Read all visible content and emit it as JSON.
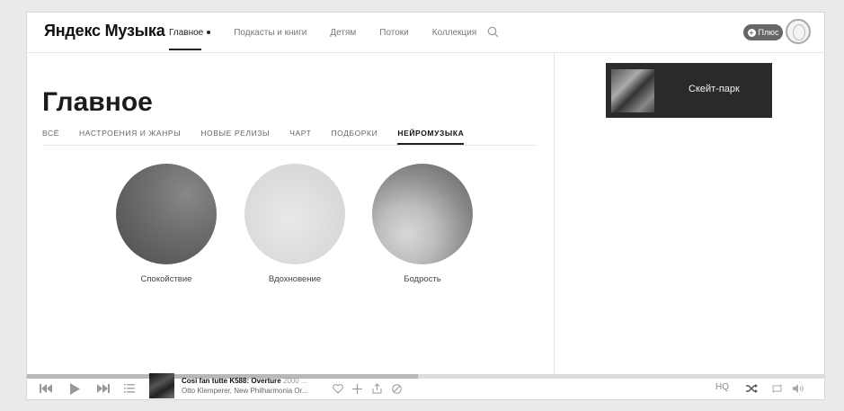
{
  "header": {
    "logo": "Яндекс Музыка",
    "nav": [
      "Главное",
      "Подкасты и книги",
      "Детям",
      "Потоки",
      "Коллекция"
    ],
    "active_nav": 0,
    "plus_label": "Плюс"
  },
  "main": {
    "title": "Главное",
    "tabs": [
      "ВСЁ",
      "НАСТРОЕНИЯ И ЖАНРЫ",
      "НОВЫЕ РЕЛИЗЫ",
      "ЧАРТ",
      "ПОДБОРКИ",
      "НЕЙРОМУЗЫКА"
    ],
    "active_tab": 5,
    "moods": [
      {
        "label": "Спокойствие"
      },
      {
        "label": "Вдохновение"
      },
      {
        "label": "Бодрость"
      }
    ]
  },
  "sidebar": {
    "promo_title": "Скейт-парк"
  },
  "player": {
    "track_title": "Cosi fan tutte K588: Overture",
    "year": "2000 ...",
    "artist": "Otto Klemperer, New Philharmonia Or...",
    "progress": 0.49,
    "quality_label": "HQ"
  },
  "icons": {
    "search": "search-icon",
    "prev": "previous-icon",
    "play": "play-icon",
    "next": "next-icon",
    "queue": "queue-icon",
    "like": "heart-icon",
    "add": "add-icon",
    "share": "share-icon",
    "block": "block-icon",
    "shuffle": "shuffle-icon",
    "repeat": "repeat-icon",
    "volume": "volume-icon"
  }
}
